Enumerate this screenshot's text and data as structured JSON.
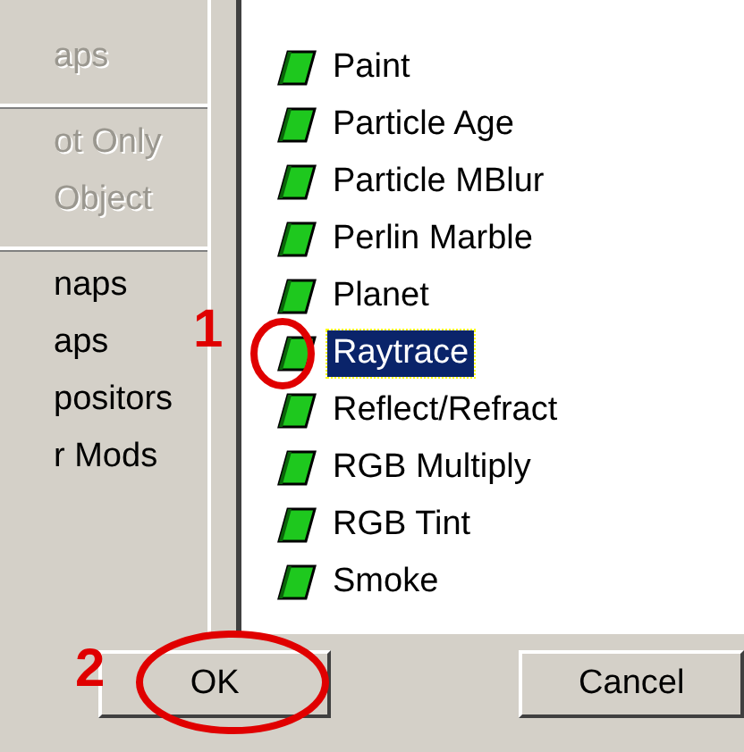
{
  "left_panel": {
    "groups": [
      {
        "items": [
          {
            "label": "aps",
            "disabled": true
          }
        ]
      },
      {
        "items": [
          {
            "label": "ot Only",
            "disabled": true
          },
          {
            "label": "Object",
            "disabled": true
          }
        ]
      },
      {
        "items": [
          {
            "label": "naps",
            "disabled": false
          },
          {
            "label": "aps",
            "disabled": false
          },
          {
            "label": "positors",
            "disabled": false
          },
          {
            "label": "r Mods",
            "disabled": false
          }
        ]
      }
    ]
  },
  "map_list": {
    "items": [
      {
        "label": "Paint",
        "selected": false
      },
      {
        "label": "Particle Age",
        "selected": false
      },
      {
        "label": "Particle MBlur",
        "selected": false
      },
      {
        "label": "Perlin Marble",
        "selected": false
      },
      {
        "label": "Planet",
        "selected": false
      },
      {
        "label": "Raytrace",
        "selected": true
      },
      {
        "label": "Reflect/Refract",
        "selected": false
      },
      {
        "label": "RGB Multiply",
        "selected": false
      },
      {
        "label": "RGB Tint",
        "selected": false
      },
      {
        "label": "Smoke",
        "selected": false
      }
    ]
  },
  "buttons": [
    {
      "label": "OK"
    },
    {
      "label": "Cancel"
    }
  ],
  "annotations": [
    {
      "label": "1"
    },
    {
      "label": "2"
    }
  ]
}
